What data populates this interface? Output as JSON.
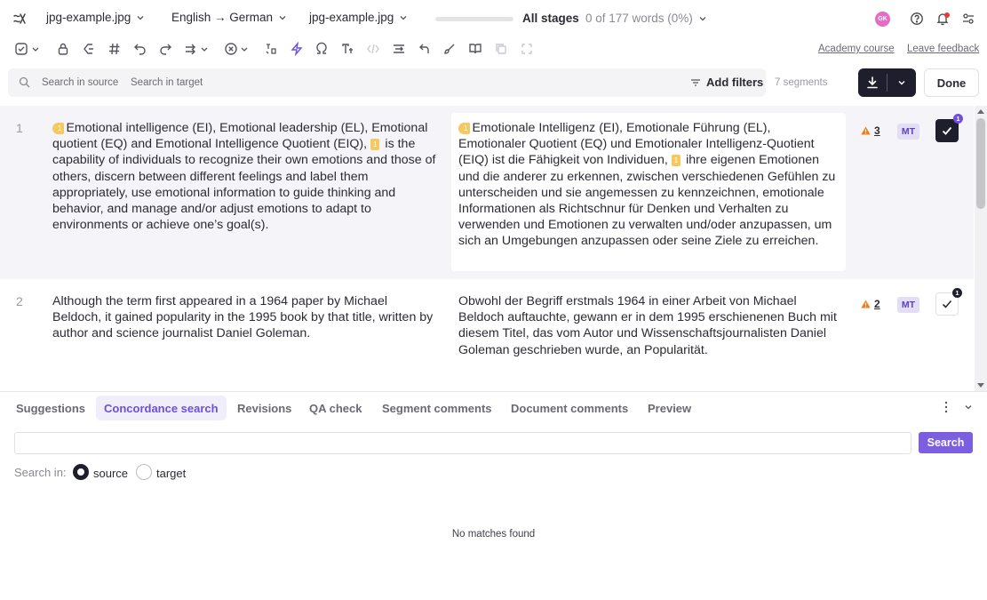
{
  "header": {
    "project_name": "jpg-example.jpg",
    "language_pair": "English → German",
    "file_name": "jpg-example.jpg",
    "progress_fraction": 0,
    "stages": "All stages",
    "word_count": "0 of 177 words (0%)",
    "avatar_initials": "GK",
    "colors": {
      "avatar": "#e46cc4",
      "notification_dot": "#e53935"
    }
  },
  "toolbar": {
    "icons": [
      "confirm-dropdown-icon",
      "lock-icon",
      "clear-icon",
      "hash-icon",
      "undo-icon",
      "redo-icon",
      "copy-source-icon",
      "cancel-icon",
      "tag-icon",
      "lightning-icon",
      "omega-icon",
      "text-case-icon",
      "code-icon",
      "join-icon",
      "back-icon",
      "brush-icon",
      "book-icon",
      "copy-icon",
      "expand-icon"
    ],
    "academy_link": "Academy course",
    "feedback_link": "Leave feedback"
  },
  "search": {
    "source_placeholder": "Search in source",
    "target_placeholder": "Search in target",
    "filters_label": "Add filters",
    "segment_count": "7 segments",
    "done_label": "Done"
  },
  "segments": [
    {
      "number": "1",
      "source_parts": [
        "Emotional intelligence (EI), Emotional leadership (EL), Emotional quotient (EQ) and Emotional Intelligence Quotient (EIQ), ",
        " is the capability of individuals to recognize their own emotions and those of others, discern between different feelings and label them appropriately, use emotional information to guide thinking and behavior, and manage and/or adjust emotions to adapt to environments or achieve one’s goal(s)."
      ],
      "target_parts": [
        "Emotionale Intelligenz (EI), Emotionale Führung (EL), Emotionaler Quotient (EQ) und Emotionaler Intelligenz-Quotient (EIQ) ist die Fähigkeit von Individuen, ",
        " ihre eigenen Emotionen und die anderer zu erkennen, zwischen verschiedenen Gefühlen zu unterscheiden und sie angemessen zu kennzeichnen, emotionale Informationen als Richtschnur für Denken und Verhalten zu verwenden und Emotionen zu verwalten und/oder anzupassen, um sich an Umgebungen anzupassen oder seine Ziele zu erreichen."
      ],
      "tag_label": "1",
      "qa_count": "3",
      "mt_label": "MT",
      "confirm_badge": "1",
      "confirmed": true
    },
    {
      "number": "2",
      "source": "Although the term first appeared in a 1964 paper by Michael Beldoch, it gained popularity in the 1995 book by that title, written by author and science journalist Daniel Goleman.",
      "target": "Obwohl der Begriff erstmals 1964 in einer Arbeit von Michael Beldoch auftauchte, gewann er in dem 1995 erschienenen Buch mit diesem Titel, das vom Autor und Wissenschaftsjournalisten Daniel Goleman geschrieben wurde, an Popularität.",
      "qa_count": "2",
      "mt_label": "MT",
      "confirm_badge": "1",
      "confirmed": false
    }
  ],
  "bottom_panel": {
    "tabs": [
      "Suggestions",
      "Concordance search",
      "Revisions",
      "QA check",
      "Segment comments",
      "Document comments",
      "Preview"
    ],
    "active_tab": "Concordance search",
    "search_button": "Search",
    "search_in_label": "Search in:",
    "radio_source": "source",
    "radio_target": "target",
    "selected_scope": "source",
    "no_matches": "No matches found"
  },
  "colors": {
    "accent": "#6e4fd9",
    "dark": "#1e1e2c",
    "tag": "#f6c860",
    "warning": "#f07b1a"
  }
}
